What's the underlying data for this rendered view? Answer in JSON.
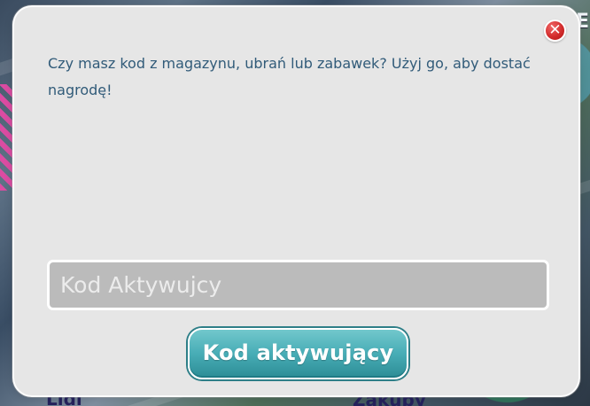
{
  "background": {
    "top_right_sign": "UME",
    "bottom_left_label": "Lidl",
    "bottom_right_label": "Zakupy"
  },
  "dialog": {
    "message": "Czy masz kod z magazynu, ubrań lub zabawek? Użyj go, aby dostać nagrodę!",
    "input": {
      "value": "",
      "placeholder": "Kod Aktywujcy"
    },
    "submit_label": "Kod aktywujący",
    "close_icon": "close-icon",
    "colors": {
      "panel": "#e6e6e6",
      "text": "#315b79",
      "button": "#49aeb7",
      "close": "#d32d2d"
    }
  }
}
